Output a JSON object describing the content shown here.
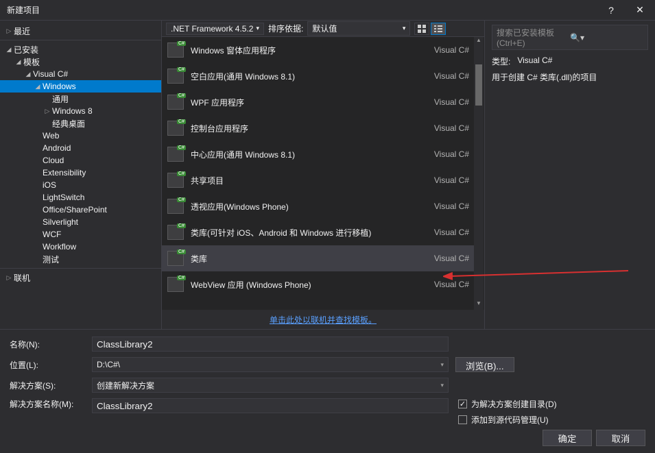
{
  "titlebar": {
    "title": "新建项目",
    "help": "?",
    "close": "✕"
  },
  "toolbar": {
    "framework": ".NET Framework 4.5.2",
    "sort_label": "排序依据:",
    "sort_value": "默认值"
  },
  "search": {
    "placeholder": "搜索已安装模板(Ctrl+E)"
  },
  "sidebar": {
    "recent": "最近",
    "installed": "已安装",
    "templates": "模板",
    "vc": "Visual C#",
    "windows": "Windows",
    "sub_common": "通用",
    "sub_win8": "Windows 8",
    "sub_classic": "经典桌面",
    "web": "Web",
    "android": "Android",
    "cloud": "Cloud",
    "extensibility": "Extensibility",
    "ios": "iOS",
    "lightswitch": "LightSwitch",
    "office": "Office/SharePoint",
    "silverlight": "Silverlight",
    "wcf": "WCF",
    "workflow": "Workflow",
    "test": "测试",
    "online": "联机"
  },
  "templates": {
    "lang": "Visual C#",
    "t0": "Windows 窗体应用程序",
    "t1": "空白应用(通用 Windows 8.1)",
    "t2": "WPF 应用程序",
    "t3": "控制台应用程序",
    "t4": "中心应用(通用 Windows 8.1)",
    "t5": "共享项目",
    "t6": "透视应用(Windows Phone)",
    "t7": "类库(可针对 iOS、Android 和 Windows 进行移植)",
    "t8": "类库",
    "t9": "WebView 应用 (Windows Phone)"
  },
  "online_link": "单击此处以联机并查找模板。",
  "right": {
    "type_label": "类型:",
    "type_value": "Visual C#",
    "desc": "用于创建 C# 类库(.dll)的项目"
  },
  "form": {
    "name_label": "名称(N):",
    "name_value": "ClassLibrary2",
    "location_label": "位置(L):",
    "location_value": "D:\\C#\\",
    "solution_label": "解决方案(S):",
    "solution_value": "创建新解决方案",
    "solution_name_label": "解决方案名称(M):",
    "solution_name_value": "ClassLibrary2",
    "browse": "浏览(B)...",
    "check_create_dir": "为解决方案创建目录(D)",
    "check_source_control": "添加到源代码管理(U)"
  },
  "actions": {
    "ok": "确定",
    "cancel": "取消"
  }
}
